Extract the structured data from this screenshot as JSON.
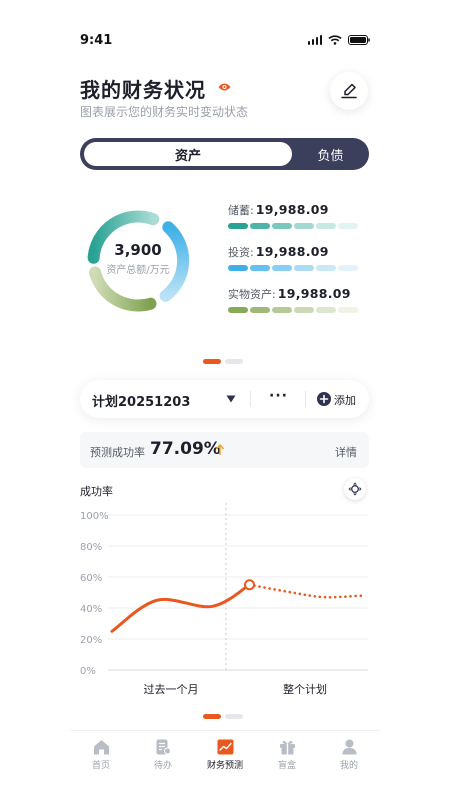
{
  "status": {
    "time": "9:41"
  },
  "header": {
    "title": "我的财务状况",
    "subtitle": "图表展示您的财务实时变动状态"
  },
  "segment": {
    "active": "资产",
    "inactive": "负债"
  },
  "summary": {
    "total_value": "3,900",
    "total_label": "资产总额/万元",
    "items": [
      {
        "label": "储蓄:",
        "value": "19,988.09",
        "colors": [
          "#2aa293",
          "#4fb4a7",
          "#7cc7bd",
          "#a5d8d1",
          "#c8e8e3",
          "#e3f3f1"
        ]
      },
      {
        "label": "投资:",
        "value": "19,988.09",
        "colors": [
          "#3eb0e6",
          "#64c0ec",
          "#89cff1",
          "#acdcf5",
          "#cbe8f8",
          "#e4f3fb"
        ]
      },
      {
        "label": "实物资产:",
        "value": "19,988.09",
        "colors": [
          "#87a95a",
          "#9fba78",
          "#b5ca96",
          "#cbdab4",
          "#dde7cf",
          "#eef3e6"
        ]
      }
    ]
  },
  "plan": {
    "name": "计划20251203",
    "more": "···",
    "add_label": "添加"
  },
  "prediction": {
    "label": "预测成功率",
    "value": "77.09%",
    "detail": "详情"
  },
  "chart_data": {
    "type": "line",
    "title": "成功率",
    "y_ticks": [
      "100%",
      "80%",
      "60%",
      "40%",
      "20%",
      "0%"
    ],
    "ylim": [
      0,
      100
    ],
    "x_sections": [
      "过去一个月",
      "整个计划"
    ],
    "series": [
      {
        "style": "solid",
        "color": "#e8581f",
        "points": [
          [
            0,
            25
          ],
          [
            0.18,
            45
          ],
          [
            0.4,
            41
          ],
          [
            0.55,
            55
          ]
        ]
      },
      {
        "style": "dotted",
        "color": "#e8581f",
        "points": [
          [
            0.55,
            55
          ],
          [
            0.72,
            50
          ],
          [
            0.85,
            47
          ],
          [
            1.0,
            48
          ]
        ]
      }
    ],
    "marker_value": 55,
    "grid": true
  },
  "tabbar": {
    "items": [
      {
        "label": "首页",
        "icon": "home-icon"
      },
      {
        "label": "待办",
        "icon": "todo-icon"
      },
      {
        "label": "财务预测",
        "icon": "forecast-icon",
        "active": true
      },
      {
        "label": "盲盒",
        "icon": "gift-icon"
      },
      {
        "label": "我的",
        "icon": "profile-icon"
      }
    ]
  },
  "colors": {
    "accent": "#e8581f",
    "dark": "#3b3f5c",
    "donut_savings": "#2aa293",
    "donut_invest": "#3eb0e6",
    "donut_physical": "#87a95a"
  }
}
